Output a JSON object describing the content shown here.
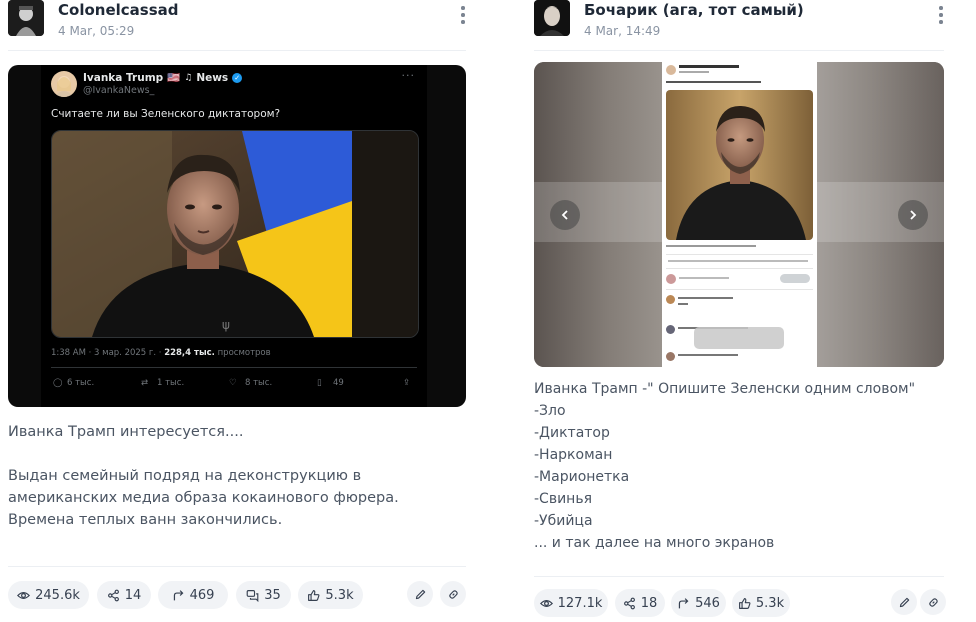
{
  "posts": [
    {
      "author": "Colonelcassad",
      "date": "4 Mar, 05:29",
      "tweet": {
        "name": "Ivanka Trump",
        "flag": "🇺🇸",
        "tag": "News",
        "handle": "@IvankaNews_",
        "question": "Считаете ли вы Зеленского диктатором?",
        "meta_time": "1:38 AM · 3 мар. 2025 г. · ",
        "meta_views": "228,4 тыс.",
        "meta_suffix": " просмотров",
        "replies": "6 тыс.",
        "retweets": "1 тыс.",
        "likes": "8 тыс.",
        "bookmarks": "49"
      },
      "text": "Иванка Трамп интересуется....\n\nВыдан семейный подряд на деконструкцию в американских медиа образа кокаинового фюрера. Времена теплых ванн закончились.",
      "stats": {
        "views": "245.6k",
        "shares": "14",
        "forwards": "469",
        "comments": "35",
        "likes": "5.3k"
      }
    },
    {
      "author": "Бочарик (ага, тот самый)",
      "date": "4 Mar, 14:49",
      "text_lines": [
        "Иванка Трамп -\" Опишите Зеленски одним словом\"",
        "-Зло",
        "-Диктатор",
        "-Наркоман",
        "-Марионетка",
        "-Свинья",
        "-Убийца",
        "... и так далее на много экранов"
      ],
      "stats": {
        "views": "127.1k",
        "shares": "18",
        "forwards": "546",
        "likes": "5.3k"
      }
    }
  ],
  "colors": {
    "accent_blue": "#1d9bf0",
    "flag_blue": "#2d5bd7",
    "flag_yellow": "#f5c518",
    "pill_bg": "#f1f3f6"
  }
}
